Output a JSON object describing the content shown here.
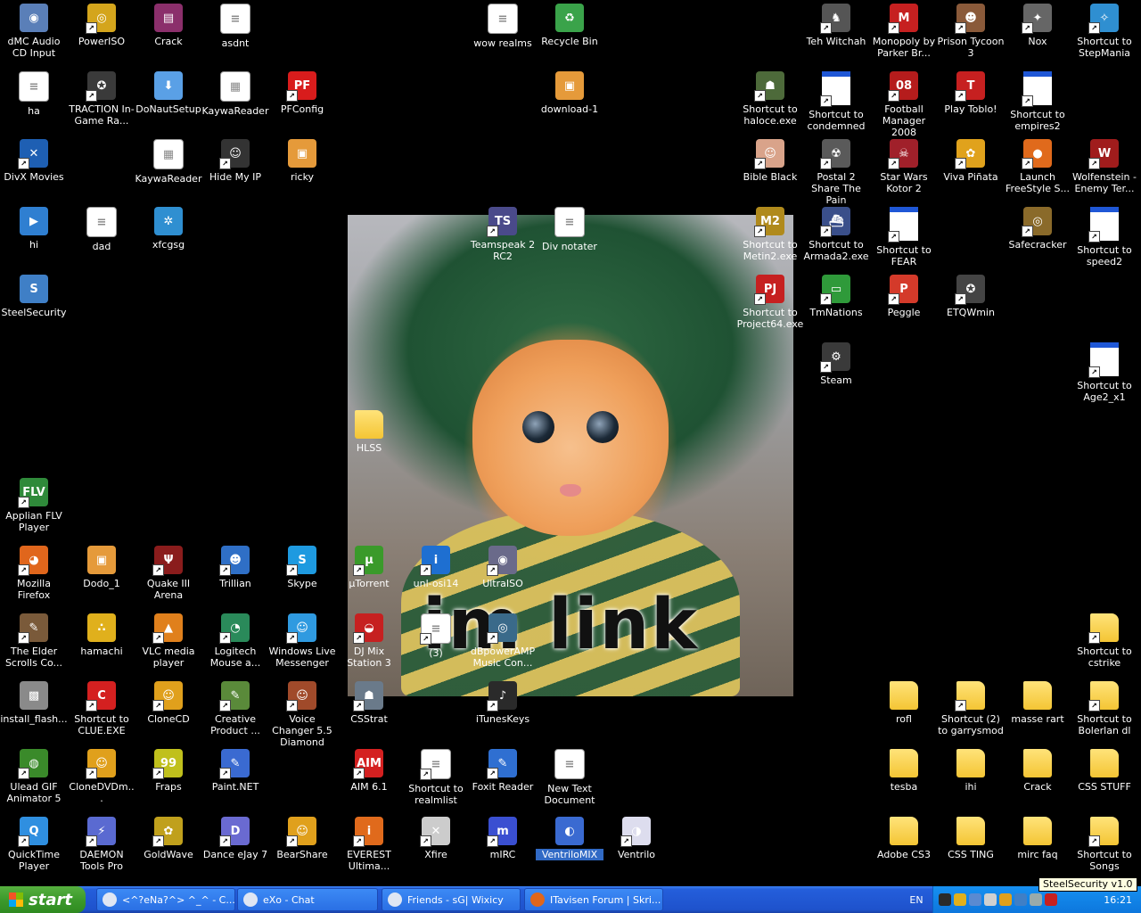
{
  "wallpaper": {
    "caption": "im link"
  },
  "icons": [
    {
      "label": "dMC Audio CD Input",
      "glyph": "◉",
      "color": "#5a7fb8",
      "kind": "app",
      "shortcut": false
    },
    {
      "label": "PowerISO",
      "glyph": "◎",
      "color": "#d4a51c",
      "kind": "app",
      "shortcut": true
    },
    {
      "label": "Crack",
      "glyph": "▤",
      "color": "#8b2f6b",
      "kind": "app",
      "shortcut": false
    },
    {
      "label": "asdnt",
      "glyph": "≡",
      "color": "#ffffff",
      "kind": "doc",
      "shortcut": false
    },
    {
      "label": "wow realms",
      "glyph": "≡",
      "color": "#ffffff",
      "kind": "doc",
      "shortcut": false
    },
    {
      "label": "Recycle Bin",
      "glyph": "♻",
      "color": "#3aa34a",
      "kind": "app",
      "shortcut": false
    },
    {
      "label": "Teh Witchah",
      "glyph": "♞",
      "color": "#555555",
      "kind": "app",
      "shortcut": true
    },
    {
      "label": "Monopoly by Parker Br...",
      "glyph": "M",
      "color": "#c62020",
      "kind": "app",
      "shortcut": true
    },
    {
      "label": "Prison Tycoon 3",
      "glyph": "☻",
      "color": "#8a5a3a",
      "kind": "app",
      "shortcut": true
    },
    {
      "label": "Nox",
      "glyph": "✦",
      "color": "#666666",
      "kind": "app",
      "shortcut": true
    },
    {
      "label": "Shortcut to StepMania",
      "glyph": "✧",
      "color": "#2f8fd1",
      "kind": "app",
      "shortcut": true
    },
    {
      "label": "ha",
      "glyph": "≡",
      "color": "#ffffff",
      "kind": "doc",
      "shortcut": false
    },
    {
      "label": "TRACTION In-Game Ra...",
      "glyph": "✪",
      "color": "#3a3a3a",
      "kind": "app",
      "shortcut": true
    },
    {
      "label": "DoNautSetup",
      "glyph": "⬇",
      "color": "#5aa0e6",
      "kind": "app",
      "shortcut": false
    },
    {
      "label": "KaywaReader",
      "glyph": "▦",
      "color": "#ffffff",
      "kind": "doc",
      "shortcut": false
    },
    {
      "label": "PFConfig",
      "glyph": "PF",
      "color": "#d81c1c",
      "kind": "app",
      "shortcut": true
    },
    {
      "label": "download-1",
      "glyph": "▣",
      "color": "#e59a3a",
      "kind": "app",
      "shortcut": false
    },
    {
      "label": "Shortcut to haloce.exe",
      "glyph": "☗",
      "color": "#4d6a3a",
      "kind": "app",
      "shortcut": true
    },
    {
      "label": "Shortcut to condemned",
      "glyph": "",
      "color": "#ffffff",
      "kind": "win",
      "shortcut": true
    },
    {
      "label": "Football Manager 2008",
      "glyph": "08",
      "color": "#b51c1c",
      "kind": "app",
      "shortcut": true
    },
    {
      "label": "Play Toblo!",
      "glyph": "T",
      "color": "#c62020",
      "kind": "app",
      "shortcut": true
    },
    {
      "label": "Shortcut to empires2",
      "glyph": "",
      "color": "#ffffff",
      "kind": "win",
      "shortcut": true
    },
    {
      "label": "DivX Movies",
      "glyph": "✕",
      "color": "#1e5fb3",
      "kind": "app",
      "shortcut": true
    },
    {
      "label": "KaywaReader",
      "glyph": "▦",
      "color": "#ffffff",
      "kind": "doc",
      "shortcut": false
    },
    {
      "label": "Hide My IP",
      "glyph": "☺",
      "color": "#333333",
      "kind": "app",
      "shortcut": true
    },
    {
      "label": "ricky",
      "glyph": "▣",
      "color": "#e59a3a",
      "kind": "app",
      "shortcut": false
    },
    {
      "label": "Bible Black",
      "glyph": "☺",
      "color": "#d9a38a",
      "kind": "app",
      "shortcut": true
    },
    {
      "label": "Postal 2 Share The Pain",
      "glyph": "☢",
      "color": "#5a5a5a",
      "kind": "app",
      "shortcut": true
    },
    {
      "label": "Star Wars Kotor 2",
      "glyph": "☠",
      "color": "#a0202a",
      "kind": "app",
      "shortcut": true
    },
    {
      "label": "Viva Piñata",
      "glyph": "✿",
      "color": "#e0a21c",
      "kind": "app",
      "shortcut": true
    },
    {
      "label": "Launch FreeStyle S...",
      "glyph": "●",
      "color": "#e06a1c",
      "kind": "app",
      "shortcut": true
    },
    {
      "label": "Wolfenstein - Enemy Ter...",
      "glyph": "W",
      "color": "#a01c1c",
      "kind": "app",
      "shortcut": true
    },
    {
      "label": "hi",
      "glyph": "▶",
      "color": "#2f7fd1",
      "kind": "app",
      "shortcut": false
    },
    {
      "label": "dad",
      "glyph": "≡",
      "color": "#ffffff",
      "kind": "doc",
      "shortcut": false
    },
    {
      "label": "xfcgsg",
      "glyph": "✲",
      "color": "#2f8fd1",
      "kind": "app",
      "shortcut": false
    },
    {
      "label": "Teamspeak 2 RC2",
      "glyph": "TS",
      "color": "#4a4a8a",
      "kind": "app",
      "shortcut": true
    },
    {
      "label": "Div notater",
      "glyph": "≡",
      "color": "#ffffff",
      "kind": "doc",
      "shortcut": false
    },
    {
      "label": "Shortcut to Metin2.exe",
      "glyph": "M2",
      "color": "#b08a1c",
      "kind": "app",
      "shortcut": true
    },
    {
      "label": "Shortcut to Armada2.exe",
      "glyph": "⛴",
      "color": "#3a4f8a",
      "kind": "app",
      "shortcut": true
    },
    {
      "label": "Shortcut to FEAR",
      "glyph": "",
      "color": "#ffffff",
      "kind": "win",
      "shortcut": true
    },
    {
      "label": "Safecracker",
      "glyph": "◎",
      "color": "#8a6a2a",
      "kind": "app",
      "shortcut": true
    },
    {
      "label": "Shortcut to speed2",
      "glyph": "",
      "color": "#ffffff",
      "kind": "win",
      "shortcut": true
    },
    {
      "label": "SteelSecurity",
      "glyph": "S",
      "color": "#3f7fc6",
      "kind": "app",
      "shortcut": false
    },
    {
      "label": "Shortcut to Project64.exe",
      "glyph": "PJ",
      "color": "#c62020",
      "kind": "app",
      "shortcut": true
    },
    {
      "label": "TmNations",
      "glyph": "▭",
      "color": "#2f9a3a",
      "kind": "app",
      "shortcut": true
    },
    {
      "label": "Peggle",
      "glyph": "P",
      "color": "#d43a2a",
      "kind": "app",
      "shortcut": true
    },
    {
      "label": "ETQWmin",
      "glyph": "✪",
      "color": "#444444",
      "kind": "app",
      "shortcut": true
    },
    {
      "label": "Steam",
      "glyph": "⚙",
      "color": "#3a3a3a",
      "kind": "app",
      "shortcut": true
    },
    {
      "label": "Shortcut to Age2_x1",
      "glyph": "",
      "color": "#ffffff",
      "kind": "win",
      "shortcut": true
    },
    {
      "label": "HLSS",
      "glyph": "",
      "color": "#f4c534",
      "kind": "folder",
      "shortcut": false
    },
    {
      "label": "Applian FLV Player",
      "glyph": "FLV",
      "color": "#2f8a3a",
      "kind": "app",
      "shortcut": true
    },
    {
      "label": "Mozilla Firefox",
      "glyph": "◕",
      "color": "#e0661c",
      "kind": "app",
      "shortcut": true
    },
    {
      "label": "Dodo_1",
      "glyph": "▣",
      "color": "#e59a3a",
      "kind": "app",
      "shortcut": false
    },
    {
      "label": "Quake III Arena",
      "glyph": "Ψ",
      "color": "#8a1c1c",
      "kind": "app",
      "shortcut": true
    },
    {
      "label": "Trillian",
      "glyph": "☻",
      "color": "#2f6fc6",
      "kind": "app",
      "shortcut": true
    },
    {
      "label": "Skype",
      "glyph": "S",
      "color": "#1e9ae0",
      "kind": "app",
      "shortcut": true
    },
    {
      "label": "µTorrent",
      "glyph": "µ",
      "color": "#3a9a2a",
      "kind": "app",
      "shortcut": true
    },
    {
      "label": "unl-osi14",
      "glyph": "i",
      "color": "#1e6fd1",
      "kind": "app",
      "shortcut": true
    },
    {
      "label": "UltraISO",
      "glyph": "◉",
      "color": "#6a6a8a",
      "kind": "app",
      "shortcut": true
    },
    {
      "label": "The Elder Scrolls Co...",
      "glyph": "✎",
      "color": "#7a5a3a",
      "kind": "app",
      "shortcut": true
    },
    {
      "label": "hamachi",
      "glyph": "∴",
      "color": "#e0b01c",
      "kind": "app",
      "shortcut": false
    },
    {
      "label": "VLC media player",
      "glyph": "▲",
      "color": "#e0801c",
      "kind": "app",
      "shortcut": true
    },
    {
      "label": "Logitech Mouse a...",
      "glyph": "◔",
      "color": "#2a8a5a",
      "kind": "app",
      "shortcut": true
    },
    {
      "label": "Windows Live Messenger",
      "glyph": "☺",
      "color": "#2f9ae0",
      "kind": "app",
      "shortcut": true
    },
    {
      "label": "DJ Mix Station 3",
      "glyph": "◒",
      "color": "#c62020",
      "kind": "app",
      "shortcut": true
    },
    {
      "label": "(3)",
      "glyph": "≡",
      "color": "#ffffff",
      "kind": "doc",
      "shortcut": true
    },
    {
      "label": "dBpowerAMP Music Con...",
      "glyph": "◎",
      "color": "#3a6a8a",
      "kind": "app",
      "shortcut": true
    },
    {
      "label": "Shortcut to cstrike",
      "glyph": "",
      "color": "#f4c534",
      "kind": "folder",
      "shortcut": true
    },
    {
      "label": "install_flash...",
      "glyph": "▩",
      "color": "#8a8a8a",
      "kind": "app",
      "shortcut": false
    },
    {
      "label": "Shortcut to CLUE.EXE",
      "glyph": "C",
      "color": "#d42020",
      "kind": "app",
      "shortcut": true
    },
    {
      "label": "CloneCD",
      "glyph": "☺",
      "color": "#e0a01c",
      "kind": "app",
      "shortcut": true
    },
    {
      "label": "Creative Product ...",
      "glyph": "✎",
      "color": "#5a8a3a",
      "kind": "app",
      "shortcut": true
    },
    {
      "label": "Voice Changer 5.5 Diamond",
      "glyph": "☺",
      "color": "#a04a2a",
      "kind": "app",
      "shortcut": true
    },
    {
      "label": "CSStrat",
      "glyph": "☗",
      "color": "#6a7a8a",
      "kind": "app",
      "shortcut": true
    },
    {
      "label": "iTunesKeys",
      "glyph": "♪",
      "color": "#2a2a2a",
      "kind": "app",
      "shortcut": true
    },
    {
      "label": "rofl",
      "glyph": "",
      "color": "#f4c534",
      "kind": "folder",
      "shortcut": false
    },
    {
      "label": "Shortcut (2) to garrysmod",
      "glyph": "",
      "color": "#f4c534",
      "kind": "folder",
      "shortcut": true
    },
    {
      "label": "masse rart",
      "glyph": "",
      "color": "#f4c534",
      "kind": "folder",
      "shortcut": false
    },
    {
      "label": "Shortcut to Bolerlan dl",
      "glyph": "",
      "color": "#f4c534",
      "kind": "folder",
      "shortcut": true
    },
    {
      "label": "Ulead GIF Animator 5",
      "glyph": "◍",
      "color": "#3a8a2a",
      "kind": "app",
      "shortcut": true
    },
    {
      "label": "CloneDVDm...",
      "glyph": "☺",
      "color": "#e0a01c",
      "kind": "app",
      "shortcut": true
    },
    {
      "label": "Fraps",
      "glyph": "99",
      "color": "#c0c01c",
      "kind": "app",
      "shortcut": true
    },
    {
      "label": "Paint.NET",
      "glyph": "✎",
      "color": "#3a6ad1",
      "kind": "app",
      "shortcut": true
    },
    {
      "label": "AIM 6.1",
      "glyph": "AIM",
      "color": "#d42020",
      "kind": "app",
      "shortcut": true
    },
    {
      "label": "Shortcut to realmlist",
      "glyph": "≡",
      "color": "#ffffff",
      "kind": "doc",
      "shortcut": true
    },
    {
      "label": "Foxit Reader",
      "glyph": "✎",
      "color": "#2f6fd1",
      "kind": "app",
      "shortcut": true
    },
    {
      "label": "New Text Document",
      "glyph": "≡",
      "color": "#ffffff",
      "kind": "doc",
      "shortcut": false
    },
    {
      "label": "tesba",
      "glyph": "",
      "color": "#f4c534",
      "kind": "folder",
      "shortcut": false
    },
    {
      "label": "ihi",
      "glyph": "",
      "color": "#f4c534",
      "kind": "folder",
      "shortcut": false
    },
    {
      "label": "Crack",
      "glyph": "",
      "color": "#f4c534",
      "kind": "folder",
      "shortcut": false
    },
    {
      "label": "CSS STUFF",
      "glyph": "",
      "color": "#f4c534",
      "kind": "folder",
      "shortcut": false
    },
    {
      "label": "QuickTime Player",
      "glyph": "Q",
      "color": "#2f8fe0",
      "kind": "app",
      "shortcut": true
    },
    {
      "label": "DAEMON Tools Pro",
      "glyph": "⚡",
      "color": "#5a6ad1",
      "kind": "app",
      "shortcut": true
    },
    {
      "label": "GoldWave",
      "glyph": "✿",
      "color": "#c0a01c",
      "kind": "app",
      "shortcut": true
    },
    {
      "label": "Dance eJay 7",
      "glyph": "D",
      "color": "#6a6ad1",
      "kind": "app",
      "shortcut": true
    },
    {
      "label": "BearShare",
      "glyph": "☺",
      "color": "#e0a01c",
      "kind": "app",
      "shortcut": true
    },
    {
      "label": "EVEREST Ultima...",
      "glyph": "i",
      "color": "#e06a1c",
      "kind": "app",
      "shortcut": true
    },
    {
      "label": "Xfire",
      "glyph": "✕",
      "color": "#cccccc",
      "kind": "app",
      "shortcut": true
    },
    {
      "label": "mIRC",
      "glyph": "m",
      "color": "#3a4fd1",
      "kind": "app",
      "shortcut": true
    },
    {
      "label": "VentriloMIX",
      "glyph": "◐",
      "color": "#3a6ad1",
      "kind": "app",
      "shortcut": false,
      "selected": true
    },
    {
      "label": "Ventrilo",
      "glyph": "◑",
      "color": "#dde",
      "kind": "app",
      "shortcut": true
    },
    {
      "label": "Adobe CS3",
      "glyph": "",
      "color": "#f4c534",
      "kind": "folder",
      "shortcut": false
    },
    {
      "label": "CSS TING",
      "glyph": "",
      "color": "#f4c534",
      "kind": "folder",
      "shortcut": false
    },
    {
      "label": "mirc faq",
      "glyph": "",
      "color": "#f4c534",
      "kind": "folder",
      "shortcut": false
    },
    {
      "label": "Shortcut to Songs",
      "glyph": "",
      "color": "#f4c534",
      "kind": "folder",
      "shortcut": true
    }
  ],
  "taskbar": {
    "start_label": "start",
    "tasks": [
      {
        "label": "<^?eNa?^> ^_^ - C...",
        "icon": "steam-icon"
      },
      {
        "label": "eXo - Chat",
        "icon": "steam-icon"
      },
      {
        "label": "Friends - sG| Wixicy",
        "icon": "steam-icon"
      },
      {
        "label": "ITavisen Forum | Skri...",
        "icon": "firefox-icon"
      }
    ],
    "language": "EN",
    "clock": "16:21",
    "tooltip": "SteelSecurity v1.0",
    "tray_icons": [
      "steam-icon",
      "shield-icon",
      "network-icon",
      "speaker-icon",
      "hamachi-icon",
      "steelsecurity-icon",
      "mouse-icon",
      "antivirus-icon"
    ]
  },
  "colors": {
    "desktop_bg": "#000000",
    "taskbar_blue": "#245edb",
    "start_green": "#3c9a2c",
    "tray_blue": "#0d77dd",
    "selection": "#316ac5"
  }
}
